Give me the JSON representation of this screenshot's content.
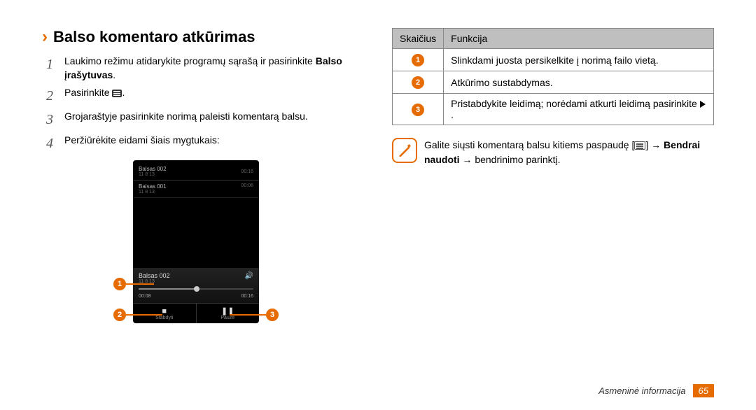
{
  "heading": {
    "title": "Balso komentaro atkūrimas"
  },
  "steps": {
    "s1_pre": "Laukimo režimu atidarykite programų sąrašą ir pasirinkite ",
    "s1_bold": "Balso įrašytuvas",
    "s2": "Pasirinkite",
    "s3": "Grojaraštyje pasirinkite norimą paleisti komentarą balsu.",
    "s4": "Peržiūrėkite eidami šiais mygtukais:"
  },
  "phone": {
    "track1_name": "Balsas 002",
    "track1_sub": "11 8 13",
    "track1_dur": "00:16",
    "track2_name": "Balsas 001",
    "track2_sub": "11 8 13",
    "track2_dur": "00:06",
    "np_name": "Balsas 002",
    "np_sub": "11 8 13",
    "np_t1": "00:08",
    "np_t2": "00:16",
    "ctl_stop": "Stabdyti",
    "ctl_pause": "Pauzė"
  },
  "callout_labels": {
    "n1": "1",
    "n2": "2",
    "n3": "3"
  },
  "table": {
    "h1": "Skaičius",
    "h2": "Funkcija",
    "r1": "Slinkdami juosta persikelkite į norimą failo vietą.",
    "r2": "Atkūrimo sustabdymas.",
    "r3_a": "Pristabdykite leidimą; norėdami atkurti leidimą pasirinkite ",
    "r3_b": "."
  },
  "note": {
    "line1_a": "Galite siųsti komentarą balsu kitiems paspaudę [",
    "line1_b": "] → ",
    "line2_bold": "Bendrai naudoti",
    "line2_rest": " → bendrinimo parinktį."
  },
  "footer": {
    "section": "Asmeninė informacija",
    "page": "65"
  }
}
